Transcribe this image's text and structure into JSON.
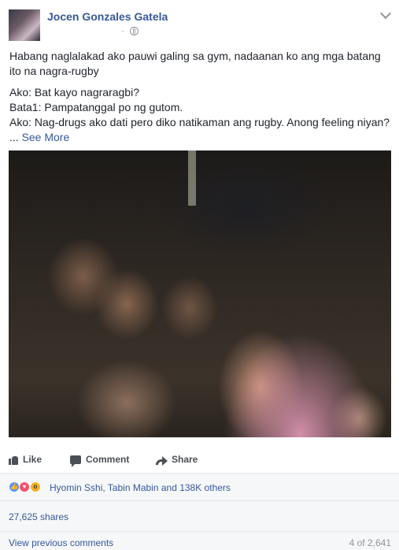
{
  "post": {
    "author": "Jocen Gonzales Gatela",
    "meta_dot": "·",
    "paragraph1": "Habang naglalakad ako pauwi galing sa gym, nadaanan ko ang mga batang ito na nagra-rugby",
    "lines": [
      "Ako: Bat kayo nagraragbi?",
      "Bata1: Pampatanggal po ng gutom.",
      "Ako: Nag-drugs ako dati pero diko natikaman ang rugby. Anong feeling niyan?"
    ],
    "ellipsis": "...",
    "see_more": "See More"
  },
  "actions": {
    "like_label": "Like",
    "comment_label": "Comment",
    "share_label": "Share"
  },
  "reactions": {
    "summary": "Hyomin Sshi, Tabin Mabin and 138K others",
    "types": [
      "like-icon",
      "love-icon",
      "wow-icon"
    ]
  },
  "shares": {
    "label": "27,625 shares"
  },
  "comments": {
    "view_previous": "View previous comments",
    "count": "4 of 2,641"
  },
  "colors": {
    "link": "#365899",
    "text": "#1d2129",
    "muted": "#90949c",
    "bar_bg": "#f6f7f9"
  }
}
